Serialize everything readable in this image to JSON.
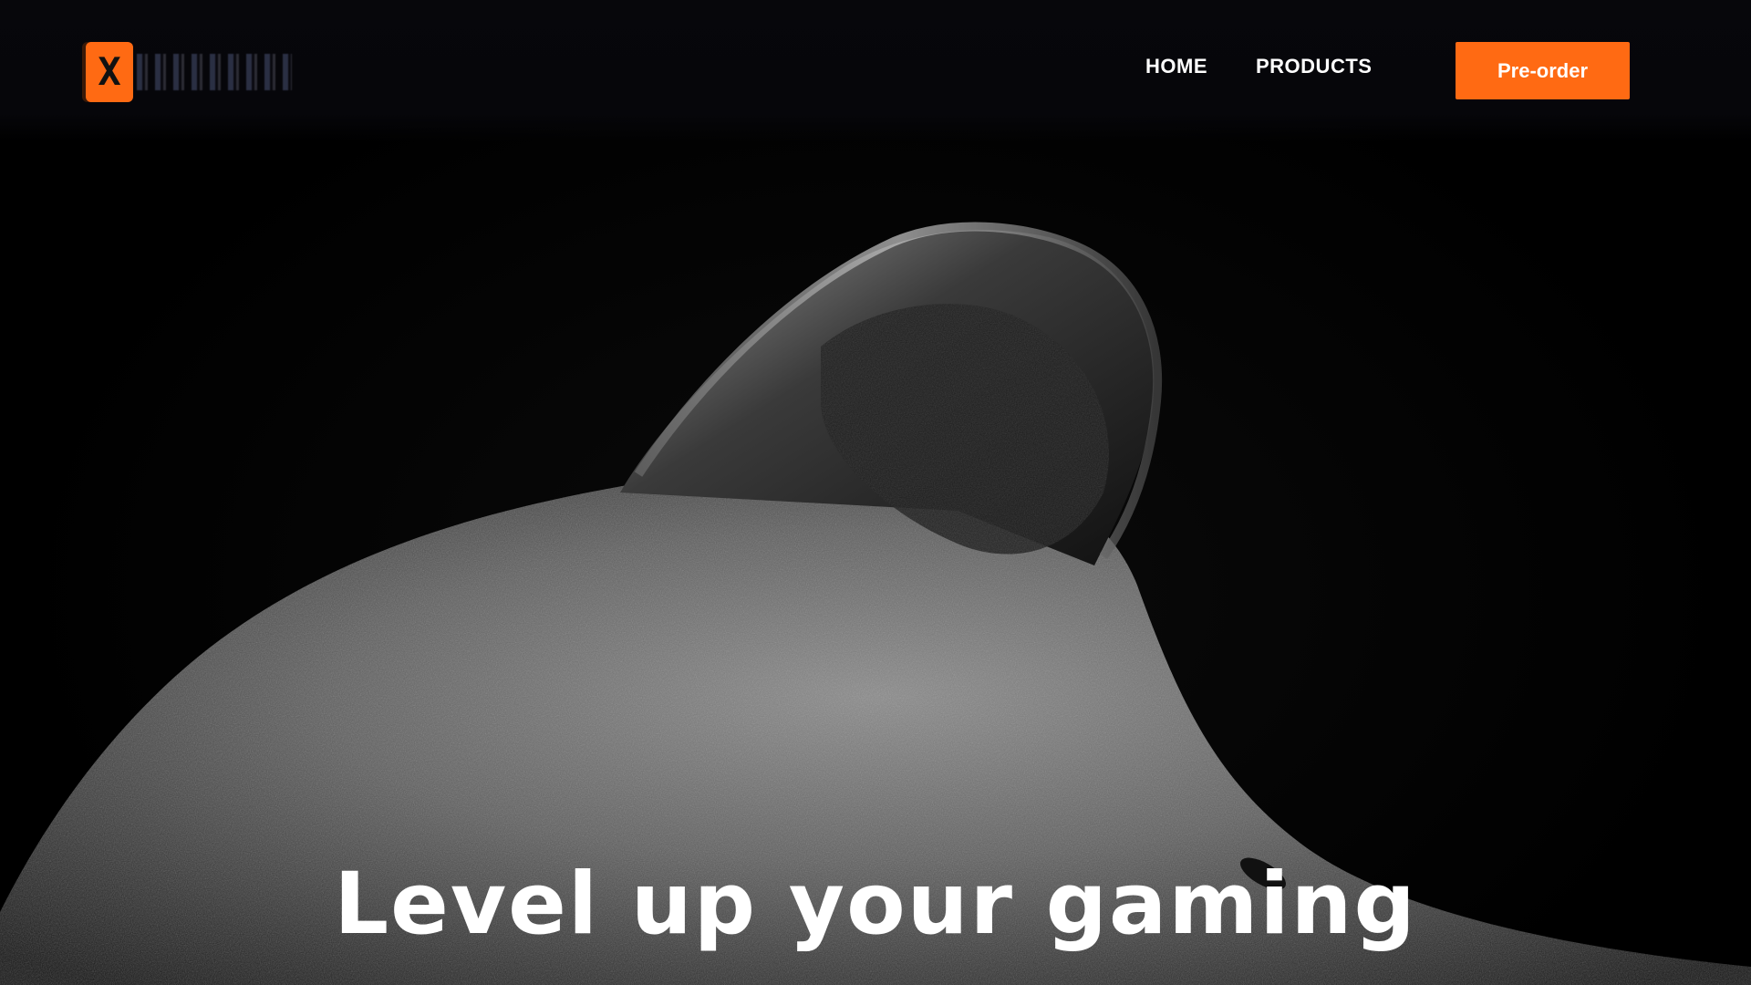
{
  "nav": {
    "items": [
      {
        "label": "HOME"
      },
      {
        "label": "PRODUCTS"
      }
    ],
    "cta_label": "Pre-order"
  },
  "logo": {
    "mark_glyph": "X",
    "mark_icon": "x-logo-icon"
  },
  "hero": {
    "headline": "Level up your gaming",
    "image_icon": "controller-closeup-image"
  },
  "colors": {
    "accent": "#ff6a13",
    "background": "#000000",
    "text": "#ffffff"
  }
}
